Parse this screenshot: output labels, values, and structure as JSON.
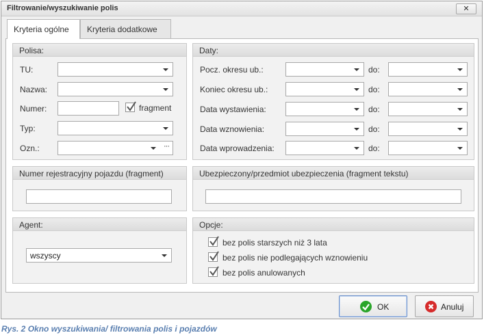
{
  "window": {
    "title": "Filtrowanie/wyszukiwanie polis",
    "close_glyph": "✕"
  },
  "tabs": [
    {
      "label": "Kryteria ogólne",
      "active": true
    },
    {
      "label": "Kryteria dodatkowe",
      "active": false
    }
  ],
  "polisa": {
    "header": "Polisa:",
    "tu_label": "TU:",
    "nazwa_label": "Nazwa:",
    "numer_label": "Numer:",
    "fragment_label": "fragment",
    "fragment_checked": true,
    "typ_label": "Typ:",
    "ozn_label": "Ozn.:",
    "ellipsis": "···"
  },
  "daty": {
    "header": "Daty:",
    "do_label": "do:",
    "rows": [
      {
        "label": "Pocz. okresu ub.:"
      },
      {
        "label": "Koniec okresu ub.:"
      },
      {
        "label": "Data wystawienia:"
      },
      {
        "label": "Data wznowienia:"
      },
      {
        "label": "Data wprowadzenia:"
      }
    ]
  },
  "vehicle": {
    "header": "Numer rejestracyjny pojazdu (fragment)",
    "value": ""
  },
  "insured": {
    "header": "Ubezpieczony/przedmiot ubezpieczenia (fragment tekstu)",
    "value": ""
  },
  "agent": {
    "header": "Agent:",
    "selected": "wszyscy"
  },
  "opcje": {
    "header": "Opcje:",
    "items": [
      {
        "label": "bez polis starszych niż 3 lata",
        "checked": true
      },
      {
        "label": "bez polis nie podlegających wznowieniu",
        "checked": true
      },
      {
        "label": "bez polis anulowanych",
        "checked": true
      }
    ]
  },
  "buttons": {
    "ok_label": "OK",
    "cancel_label": "Anuluj",
    "ok_icon": "check-circle-icon",
    "cancel_icon": "x-circle-icon",
    "ok_color": "#2aa52a",
    "cancel_color": "#d62b2b"
  },
  "caption": "Rys. 2 Okno wyszukiwania/ filtrowania polis i pojazdów"
}
